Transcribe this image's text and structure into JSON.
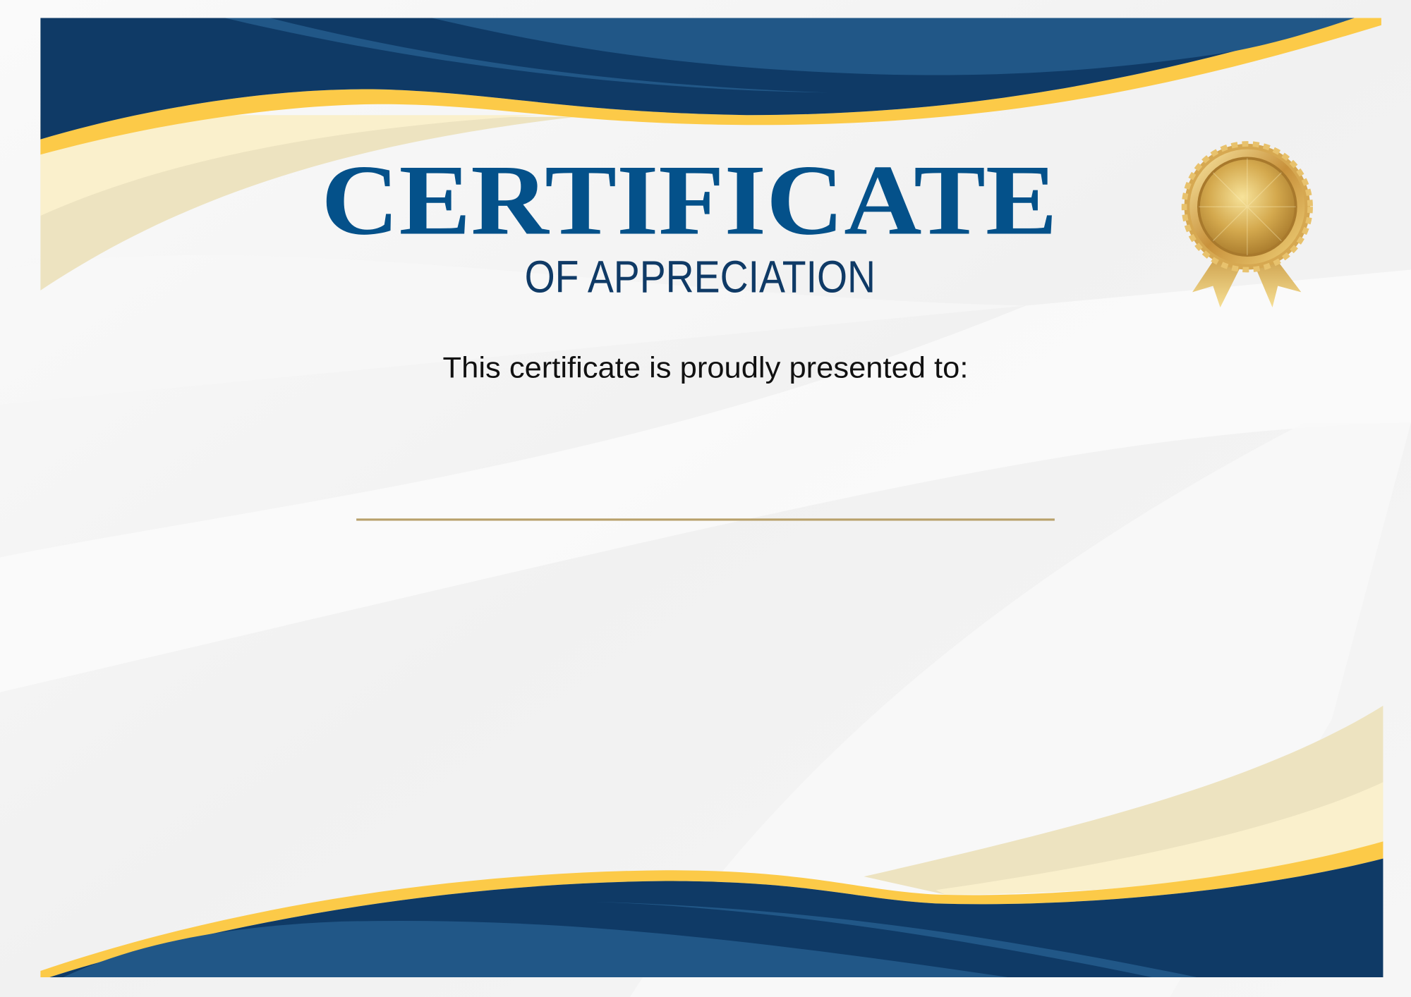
{
  "certificate": {
    "title": "CERTIFICATE",
    "subtitle": "OF APPRECIATION",
    "presented_text": "This certificate is proudly presented to:",
    "recipient_name": ""
  },
  "colors": {
    "navy": "#0f3a66",
    "blue": "#215787",
    "gold": "#fcca48",
    "cream_light": "#faf0cc",
    "cream_dark": "#ede3c0",
    "title_blue": "#04518a",
    "line_gold": "#b8a06a"
  },
  "icons": {
    "seal": "gold-medal-seal-icon"
  }
}
